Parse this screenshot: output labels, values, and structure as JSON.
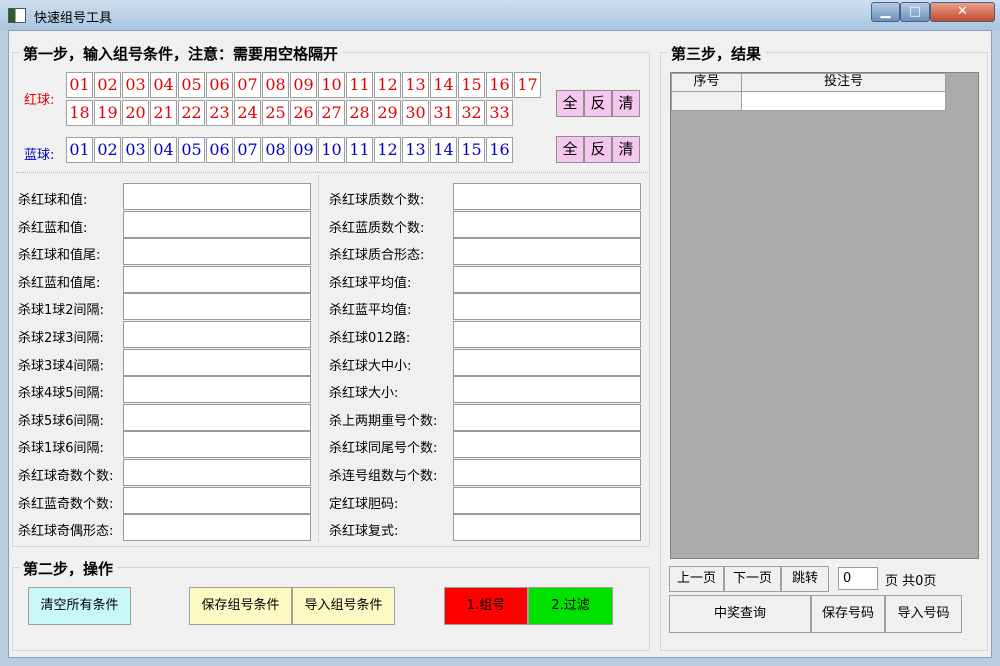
{
  "window": {
    "title": "快速组号工具",
    "min_label": "▁",
    "max_label": "□",
    "close_label": "✕"
  },
  "step1": {
    "title": "第一步，输入组号条件，注意：需要用空格隔开",
    "red_label": "红球:",
    "blue_label": "蓝球:",
    "red_balls": [
      "01",
      "02",
      "03",
      "04",
      "05",
      "06",
      "07",
      "08",
      "09",
      "10",
      "11",
      "12",
      "13",
      "14",
      "15",
      "16",
      "17",
      "18",
      "19",
      "20",
      "21",
      "22",
      "23",
      "24",
      "25",
      "26",
      "27",
      "28",
      "29",
      "30",
      "31",
      "32",
      "33"
    ],
    "blue_balls": [
      "01",
      "02",
      "03",
      "04",
      "05",
      "06",
      "07",
      "08",
      "09",
      "10",
      "11",
      "12",
      "13",
      "14",
      "15",
      "16"
    ],
    "red_buttons": [
      "全",
      "反",
      "清"
    ],
    "blue_buttons": [
      "全",
      "反",
      "清"
    ],
    "conditions_left": [
      "杀红球和值:",
      "杀红蓝和值:",
      "杀红球和值尾:",
      "杀红蓝和值尾:",
      "杀球1球2间隔:",
      "杀球2球3间隔:",
      "杀球3球4间隔:",
      "杀球4球5间隔:",
      "杀球5球6间隔:",
      "杀球1球6间隔:",
      "杀红球奇数个数:",
      "杀红蓝奇数个数:",
      "杀红球奇偶形态:"
    ],
    "conditions_right": [
      "杀红球质数个数:",
      "杀红蓝质数个数:",
      "杀红球质合形态:",
      "杀红球平均值:",
      "杀红蓝平均值:",
      "杀红球012路:",
      "杀红球大中小:",
      "杀红球大小:",
      "杀上两期重号个数:",
      "杀红球同尾号个数:",
      "杀连号组数与个数:",
      "定红球胆码:",
      "杀红球复式:"
    ]
  },
  "step2": {
    "title": "第二步，操作",
    "clear_all": "清空所有条件",
    "save_conditions": "保存组号条件",
    "import_conditions": "导入组号条件",
    "combine": "1.组号",
    "filter": "2.过滤"
  },
  "step3": {
    "title": "第三步，结果",
    "columns": [
      "序号",
      "投注号"
    ],
    "prev_page": "上一页",
    "next_page": "下一页",
    "jump": "跳转",
    "page_value": "0",
    "page_suffix": "页 共0页",
    "prize_query": "中奖查询",
    "save_numbers": "保存号码",
    "import_numbers": "导入号码"
  },
  "colors": {
    "red": "#e60000",
    "blue": "#0000c8",
    "pink_button": "#f5c6ee",
    "cyan_button": "#c8f7f7",
    "yellow_button": "#fdf9c3",
    "combine_button": "#ff0000",
    "filter_button": "#00e100"
  }
}
